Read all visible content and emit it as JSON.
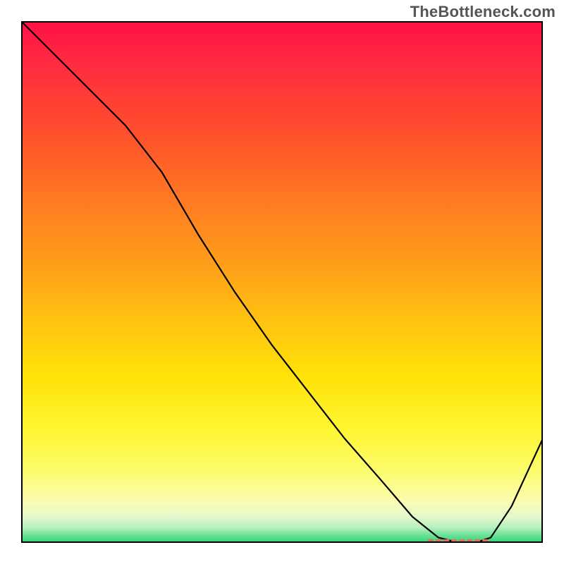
{
  "watermark": "TheBottleneck.com",
  "chart_data": {
    "type": "line",
    "title": "",
    "xlabel": "",
    "ylabel": "",
    "xlim": [
      0,
      100
    ],
    "ylim": [
      0,
      100
    ],
    "grid": false,
    "series": [
      {
        "name": "bottleneck-curve",
        "x": [
          0,
          5,
          12,
          20,
          27,
          34,
          41,
          48,
          55,
          62,
          69,
          75,
          80,
          84,
          87,
          90,
          94,
          100
        ],
        "values": [
          100,
          95,
          88,
          80,
          71,
          59,
          48,
          38,
          29,
          20,
          12,
          5,
          1,
          0,
          0,
          1,
          7,
          20
        ]
      }
    ],
    "annotations": [
      {
        "name": "bottleneck-range",
        "x0": 78,
        "x1": 90,
        "y": 0
      }
    ],
    "colors": {
      "curve": "#000000",
      "bottleneck_bar": "#e86a5a",
      "gradient_top": "#ff1045",
      "gradient_mid": "#ffe208",
      "gradient_bottom": "#2fd47a"
    }
  }
}
